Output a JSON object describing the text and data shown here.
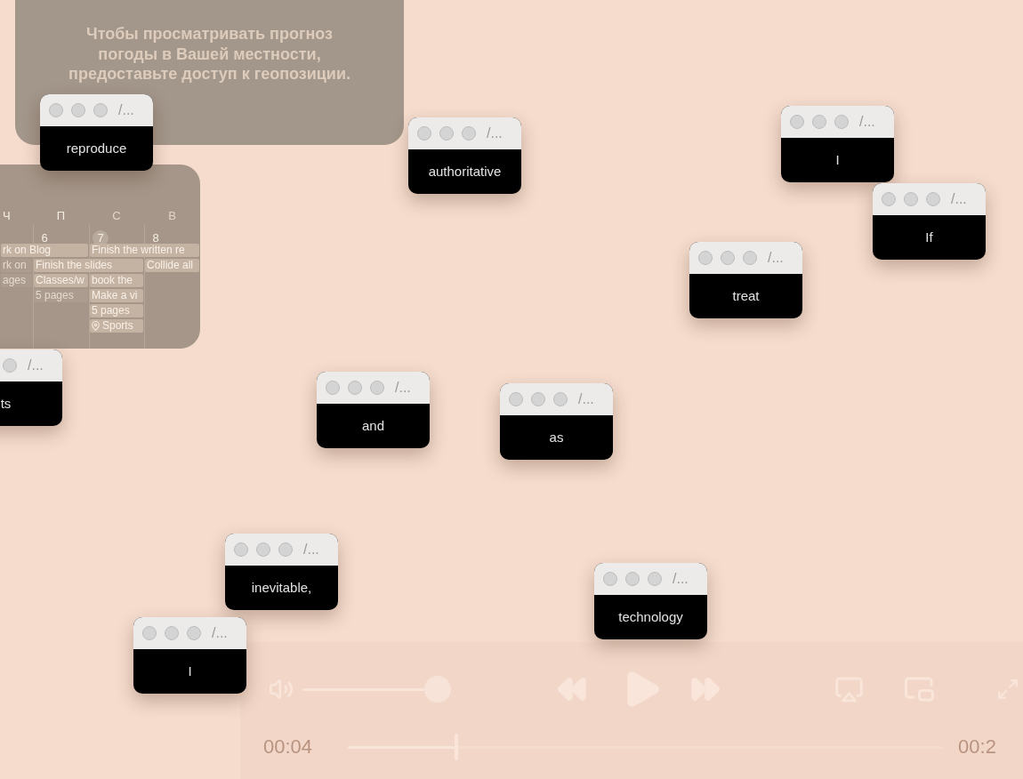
{
  "desktop": {
    "weather_widget": {
      "message": "Чтобы просматривать прогноз погоды в Вашей местности, предоставьте доступ к геопозиции."
    },
    "calendar_widget": {
      "days": [
        {
          "weekday": "Ч",
          "weekend": false
        },
        {
          "weekday": "П",
          "date": "6",
          "weekend": false,
          "today": false
        },
        {
          "weekday": "С",
          "date": "7",
          "weekend": true,
          "today": true
        },
        {
          "weekday": "В",
          "date": "8",
          "weekend": true,
          "today": false
        }
      ],
      "events": [
        {
          "title": "rk on Blog",
          "dimmed": false,
          "kind": "task"
        },
        {
          "title": "Finish the written re",
          "dimmed": false,
          "kind": "task"
        },
        {
          "title": "rk on",
          "dimmed": true,
          "kind": "task"
        },
        {
          "title": "Finish the slides",
          "dimmed": false,
          "kind": "task"
        },
        {
          "title": "Collide all",
          "dimmed": false,
          "kind": "task"
        },
        {
          "title": "ages",
          "dimmed": true,
          "kind": "task"
        },
        {
          "title": "Classes/w",
          "dimmed": false,
          "kind": "task"
        },
        {
          "title": "book the",
          "dimmed": false,
          "kind": "task"
        },
        {
          "title": "5 pages",
          "dimmed": true,
          "kind": "task"
        },
        {
          "title": "Make a vi",
          "dimmed": false,
          "kind": "task"
        },
        {
          "title": "5 pages",
          "dimmed": false,
          "kind": "task"
        },
        {
          "title": "Sports",
          "dimmed": false,
          "kind": "location"
        }
      ]
    },
    "media_player": {
      "volume": {
        "level": 1
      },
      "elapsed": "00:04",
      "progress": {
        "level": 0.18
      },
      "duration": "00:2"
    },
    "windows": [
      {
        "title": "/...",
        "text": "reproduce"
      },
      {
        "title": "/...",
        "text": "I"
      },
      {
        "title": "/...",
        "text": "authoritative"
      },
      {
        "title": "/...",
        "text": "If"
      },
      {
        "title": "/...",
        "text": "treat"
      },
      {
        "title": "/...",
        "text": "ts"
      },
      {
        "title": "/...",
        "text": "and"
      },
      {
        "title": "/...",
        "text": "as"
      },
      {
        "title": "/...",
        "text": "inevitable,"
      },
      {
        "title": "/...",
        "text": "technology"
      },
      {
        "title": "/...",
        "text": "I"
      }
    ]
  }
}
